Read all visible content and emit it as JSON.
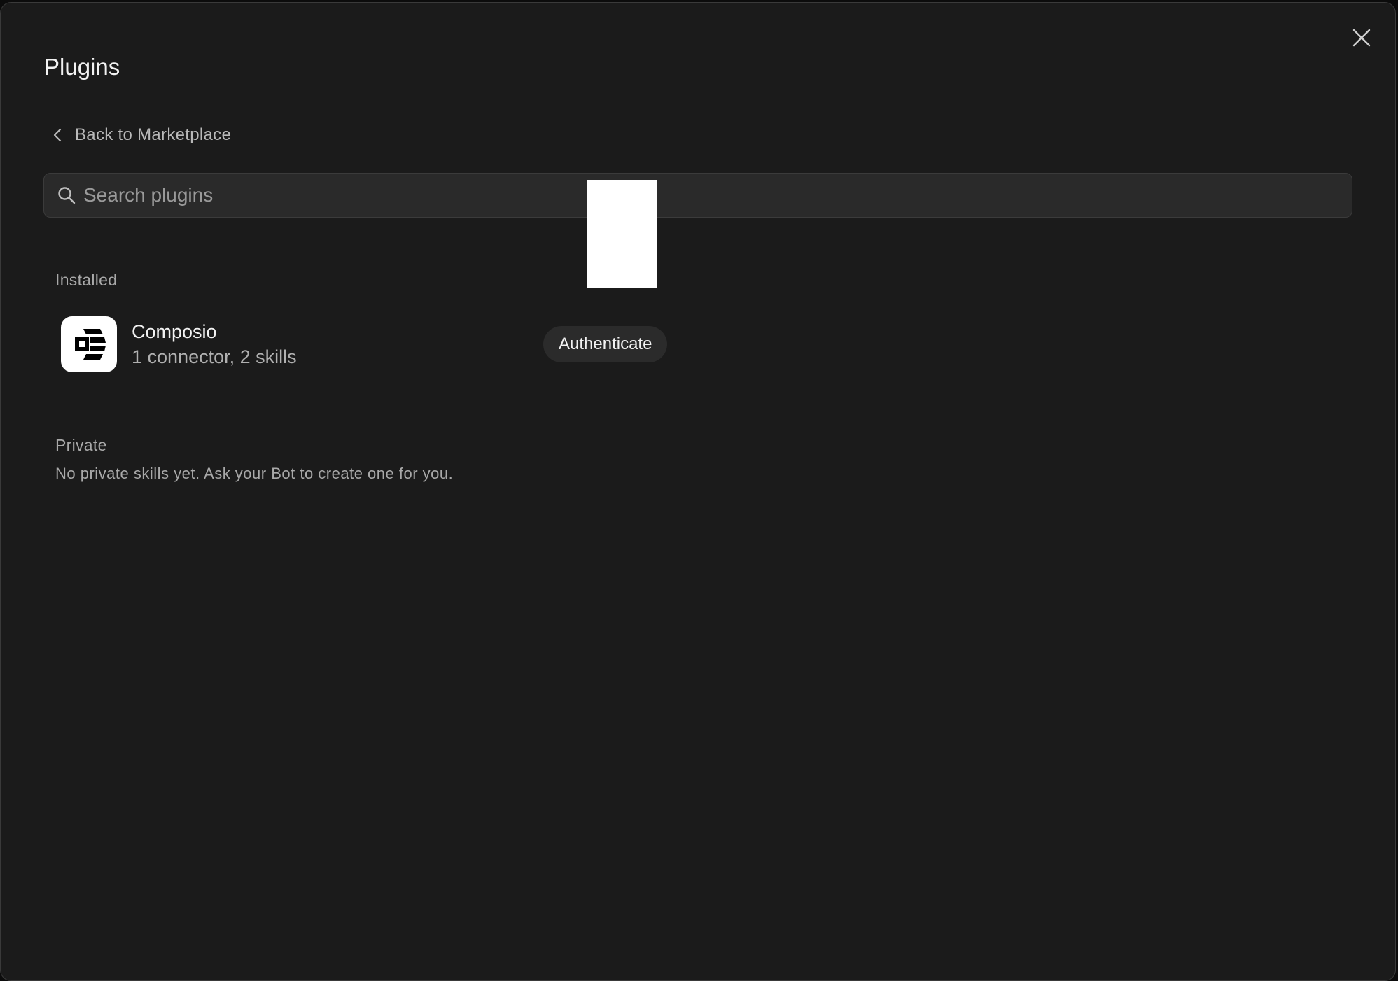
{
  "modal": {
    "title": "Plugins",
    "close_icon": "close-icon"
  },
  "nav": {
    "back_label": "Back to Marketplace",
    "back_icon": "chevron-left-icon"
  },
  "search": {
    "placeholder": "Search plugins",
    "value": "",
    "icon": "search-icon"
  },
  "installed": {
    "heading": "Installed",
    "plugins": [
      {
        "name": "Composio",
        "meta": "1 connector, 2 skills",
        "logo_icon": "composio-logo-icon",
        "action_label": "Authenticate"
      }
    ]
  },
  "private": {
    "heading": "Private",
    "empty_message": "No private skills yet. Ask your Bot to create one for you."
  },
  "colors": {
    "background": "#1b1b1b",
    "search_background": "#2a2a2a",
    "button_background": "#2b2b2b",
    "text_primary": "#f2f2f2",
    "text_secondary": "#a9a9a9"
  }
}
